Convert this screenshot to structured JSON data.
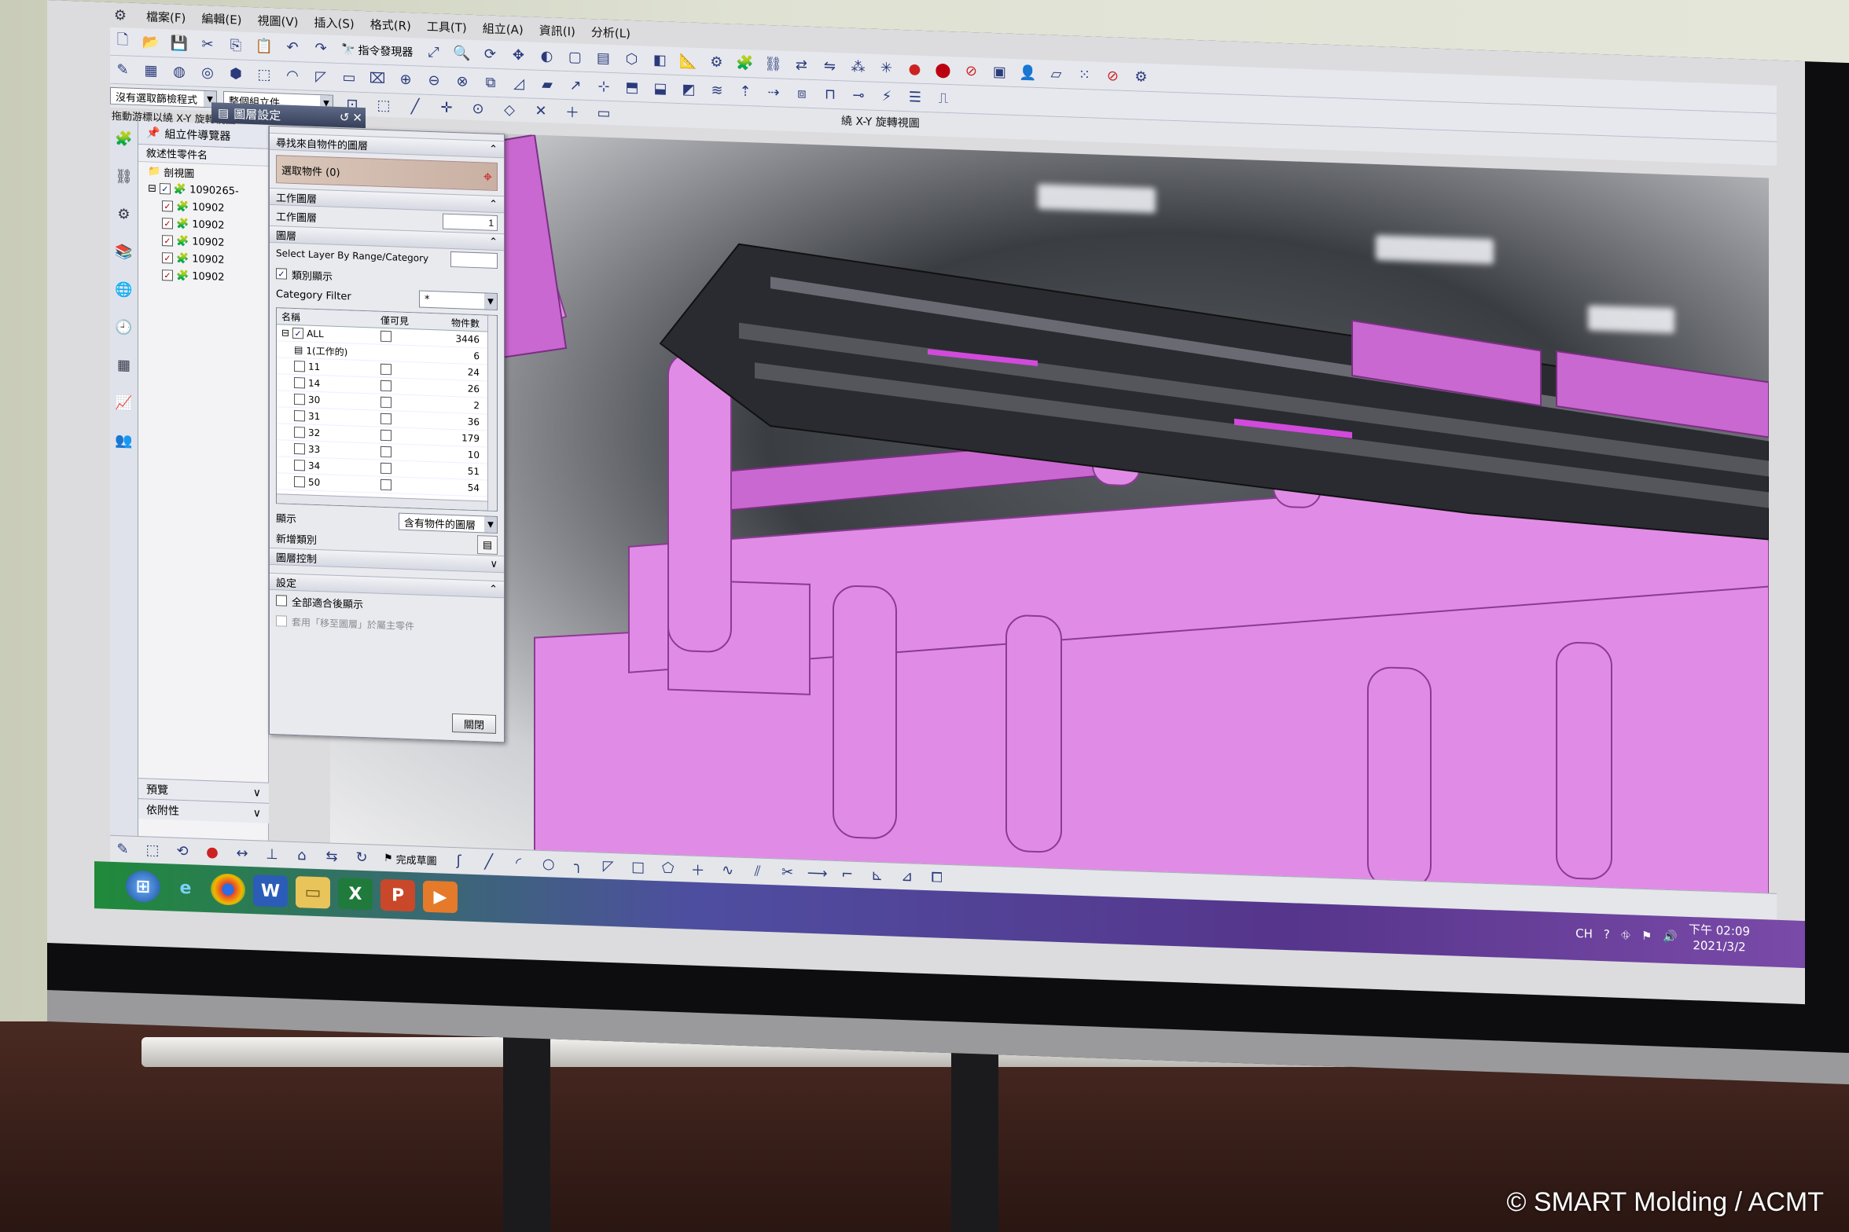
{
  "menu": [
    "檔案(F)",
    "編輯(E)",
    "視圖(V)",
    "插入(S)",
    "格式(R)",
    "工具(T)",
    "組立(A)",
    "資訊(I)",
    "分析(L)"
  ],
  "toolbar": {
    "command_finder": "指令發現器"
  },
  "selection": {
    "filter": "沒有選取篩檢程式",
    "scope": "整個組立件",
    "view_title": "繞 X-Y 旋轉視圖",
    "hint": "拖動游標以繞 X-Y 旋轉視圖"
  },
  "navigator": {
    "title": "組立件導覽器",
    "column": "敘述性零件名",
    "items": [
      "剖視圖",
      "1090265-",
      "10902",
      "10902",
      "10902",
      "10902",
      "10902"
    ],
    "footer": [
      "預覽",
      "依附性"
    ]
  },
  "dialog": {
    "title": "圖層設定",
    "sec_find": "尋找來自物件的圖層",
    "select_object": "選取物件 (0)",
    "sec_work": "工作圖層",
    "work_label": "工作圖層",
    "work_value": "1",
    "sec_layer": "圖層",
    "range_label": "Select Layer By Range/Category",
    "show_category": "類別顯示",
    "category_filter_label": "Category Filter",
    "category_filter_value": "*",
    "grid_headers": [
      "名稱",
      "僅可見",
      "物件數"
    ],
    "grid_rows": [
      {
        "name": "ALL",
        "count": "3446"
      },
      {
        "name": "1(工作的)",
        "count": "6"
      },
      {
        "name": "11",
        "count": "24"
      },
      {
        "name": "14",
        "count": "26"
      },
      {
        "name": "30",
        "count": "2"
      },
      {
        "name": "31",
        "count": "36"
      },
      {
        "name": "32",
        "count": "179"
      },
      {
        "name": "33",
        "count": "10"
      },
      {
        "name": "34",
        "count": "51"
      },
      {
        "name": "50",
        "count": "54"
      }
    ],
    "display_label": "顯示",
    "display_value": "含有物件的圖層",
    "add_category": "新增類別",
    "layer_control": "圖層控制",
    "sec_settings": "設定",
    "opt_all_fit": "全部適合後顯示",
    "opt_apply": "套用「移至圖層」於屬主零件",
    "close": "關閉"
  },
  "bottom_toolbar": {
    "sketch_label": "完成草圖"
  },
  "tray": {
    "lang": "CH",
    "time": "下午 02:09",
    "date": "2021/3/2"
  },
  "copyright": "© SMART Molding / ACMT"
}
